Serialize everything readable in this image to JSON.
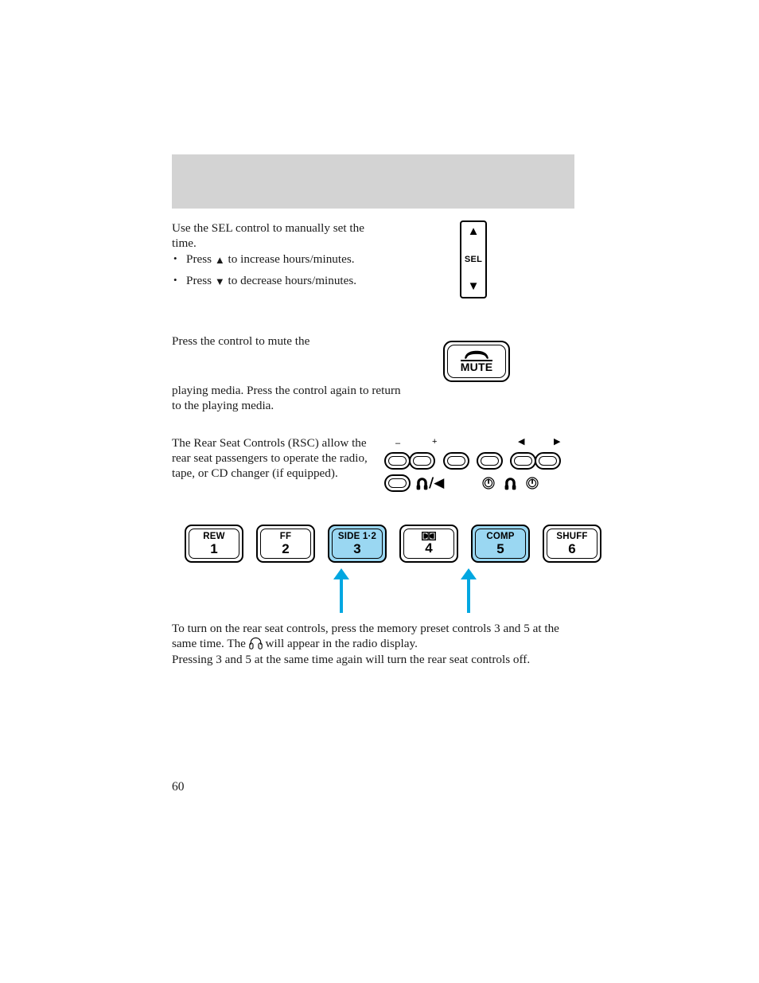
{
  "page": {
    "number": "60",
    "header_band_title": ""
  },
  "sel_section": {
    "intro": "Use the SEL control to manually set the time.",
    "bullets": [
      {
        "prefix": "Press",
        "glyph": "▲",
        "suffix": "to increase hours/minutes."
      },
      {
        "prefix": "Press",
        "glyph": "▼",
        "suffix": "to decrease hours/minutes."
      }
    ],
    "control": {
      "up_glyph": "▲",
      "label": "SEL",
      "down_glyph": "▼"
    }
  },
  "mute_section": {
    "text_before": "Press the control to mute the",
    "text_after": "playing media. Press the control again to return to the playing media.",
    "control": {
      "icon": "telephone-handset-icon",
      "label": "MUTE"
    }
  },
  "rsc_section": {
    "text": "The Rear Seat Controls (RSC) allow the rear seat passengers to operate the radio, tape, or CD changer (if equipped).",
    "panel": {
      "marks": [
        {
          "name": "minus",
          "glyph": "–"
        },
        {
          "name": "plus",
          "glyph": "+"
        },
        {
          "name": "seek-left",
          "glyph": "◀"
        },
        {
          "name": "seek-right",
          "glyph": "▶"
        }
      ],
      "bottom_icons": [
        {
          "name": "headphone-slash-left-icon",
          "glyph": "♫"
        },
        {
          "name": "power-left-icon",
          "glyph": "⏻"
        },
        {
          "name": "headphone-icon",
          "glyph": "♫"
        },
        {
          "name": "power-right-icon",
          "glyph": "⏻"
        }
      ],
      "headphone_label": "/◀"
    }
  },
  "presets": {
    "highlight_color": "#9ad7f2",
    "buttons": [
      {
        "top_label": "REW",
        "number": "1",
        "highlighted": false,
        "icon": ""
      },
      {
        "top_label": "FF",
        "number": "2",
        "highlighted": false,
        "icon": ""
      },
      {
        "top_label": "SIDE 1·2",
        "number": "3",
        "highlighted": true,
        "icon": ""
      },
      {
        "top_label": "",
        "number": "4",
        "highlighted": false,
        "icon": "dolby-icon"
      },
      {
        "top_label": "COMP",
        "number": "5",
        "highlighted": true,
        "icon": ""
      },
      {
        "top_label": "SHUFF",
        "number": "6",
        "highlighted": false,
        "icon": ""
      }
    ],
    "callout_arrow_color": "#00a7e1",
    "callout_targets": [
      "3",
      "5"
    ]
  },
  "bottom_text": {
    "paragraph_1_before": "To turn on the rear seat controls, press the memory preset controls 3 and 5 at the same time. The",
    "paragraph_1_icon": "headphone-outline-icon",
    "paragraph_1_after": "will appear in the radio display.",
    "paragraph_2": "Pressing 3 and 5 at the same time again will turn the rear seat controls off."
  }
}
